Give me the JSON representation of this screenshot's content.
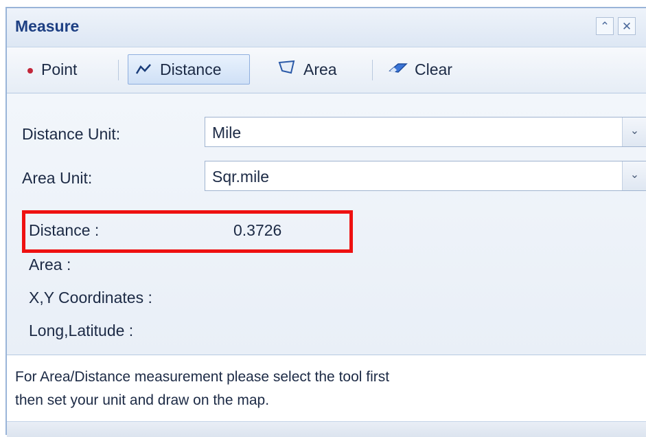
{
  "window": {
    "title": "Measure",
    "collapse_icon": "double-chevron-up-icon",
    "close_icon": "close-icon"
  },
  "toolbar": {
    "point_label": "Point",
    "distance_label": "Distance",
    "area_label": "Area",
    "clear_label": "Clear",
    "active_tool": "Distance"
  },
  "form": {
    "distance_unit_label": "Distance Unit:",
    "distance_unit_value": "Mile",
    "area_unit_label": "Area Unit:",
    "area_unit_value": "Sqr.mile"
  },
  "results": {
    "distance_label": "Distance :",
    "distance_value": "0.3726",
    "area_label": "Area :",
    "xy_label": "X,Y Coordinates :",
    "longlat_label": "Long,Latitude :"
  },
  "status": {
    "line1": "For Area/Distance measurement please select the tool first",
    "line2": "then set your unit and draw on the map."
  },
  "colors": {
    "highlight": "#ee1111",
    "title": "#1d3f83",
    "border": "#99b4d8"
  }
}
